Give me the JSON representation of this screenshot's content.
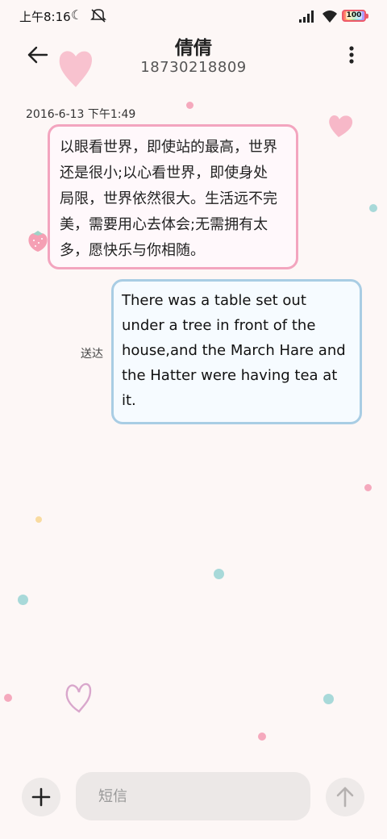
{
  "status_bar": {
    "time": "上午8:16",
    "battery": "100",
    "icons": [
      "moon-icon",
      "mute-icon",
      "signal-icon",
      "wifi-icon",
      "battery-icon"
    ]
  },
  "header": {
    "contact_name": "倩倩",
    "phone_number": "18730218809",
    "icons": [
      "back-arrow-icon",
      "more-vertical-icon"
    ]
  },
  "conversation": {
    "timestamp": "2016-6-13 下午1:49",
    "messages": [
      {
        "direction": "incoming",
        "lines": [
          "以眼看世界，即使站的最高，世界",
          "还是很小;以心看世界，即使身处",
          "局限，世界依然很大。生活远不完",
          "美，需要用心去体会;无需拥有太",
          "多，愿快乐与你相随。"
        ]
      },
      {
        "direction": "outgoing",
        "lines": [
          "There was a table set out",
          "under a tree in front of the",
          "house,and the March Hare and",
          "the Hatter were having tea at",
          "it."
        ],
        "status": "送达"
      }
    ]
  },
  "composer": {
    "placeholder": "短信",
    "icons": [
      "plus-icon",
      "send-arrow-icon"
    ]
  },
  "theme": {
    "incoming_border": "#f3a5bf",
    "outgoing_border": "#a9cde4",
    "background": "#fdf7f6"
  }
}
